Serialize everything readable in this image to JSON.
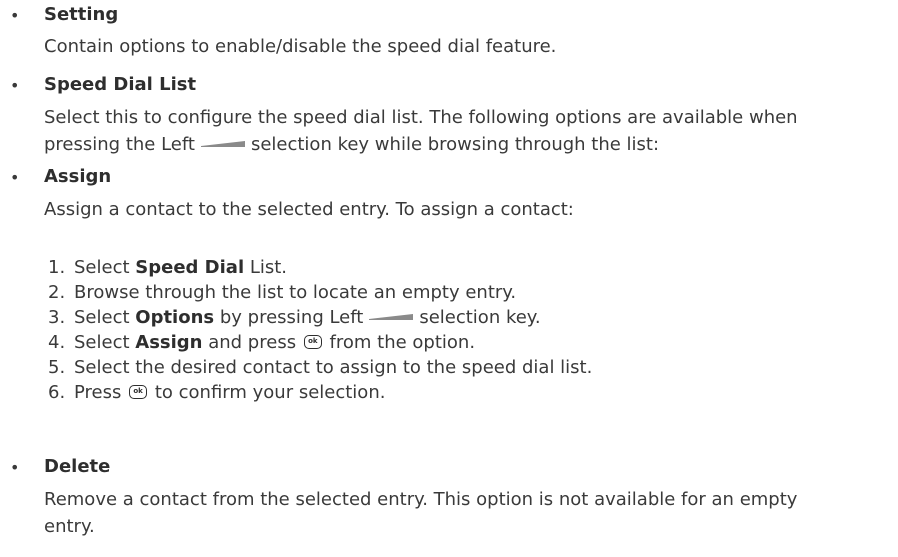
{
  "colors": {
    "text": "#3a3a3a",
    "heading": "#2e2e2e",
    "key_bar": "#8a8a8a"
  },
  "icons": {
    "left_key": "left-selection-key-bar",
    "ok_key": "ok-key-icon"
  },
  "bullet_char": "•",
  "sections": {
    "setting": {
      "heading": "Setting",
      "body": "Contain options to enable/disable the speed dial feature."
    },
    "speed_dial_list": {
      "heading": "Speed Dial List",
      "body_line1": "Select this to configure the speed dial list. The following options are available when",
      "body_line2_before": "pressing the Left",
      "body_line2_after": "selection key while browsing through the list:"
    },
    "assign": {
      "heading": "Assign",
      "body": "Assign a contact to the selected entry. To assign a contact:",
      "ok_label": "ok",
      "steps": [
        {
          "num": "1.",
          "pre": "Select ",
          "bold": "Speed Dial",
          "post": " List."
        },
        {
          "num": "2.",
          "text": "Browse through the list to locate an empty entry."
        },
        {
          "num": "3.",
          "pre": "Select ",
          "bold": "Options",
          "post": " by pressing Left",
          "post2": "selection key."
        },
        {
          "num": "4.",
          "pre": "Select ",
          "bold": "Assign",
          "post": " and press",
          "post2": "from the option."
        },
        {
          "num": "5.",
          "text": "Select the desired contact to assign to the speed dial list."
        },
        {
          "num": "6.",
          "pre": "Press",
          "post": "to confirm your selection."
        }
      ]
    },
    "delete": {
      "heading": "Delete",
      "body_line1": "Remove a contact from the selected entry. This option is not available for an empty",
      "body_line2": "entry."
    }
  }
}
